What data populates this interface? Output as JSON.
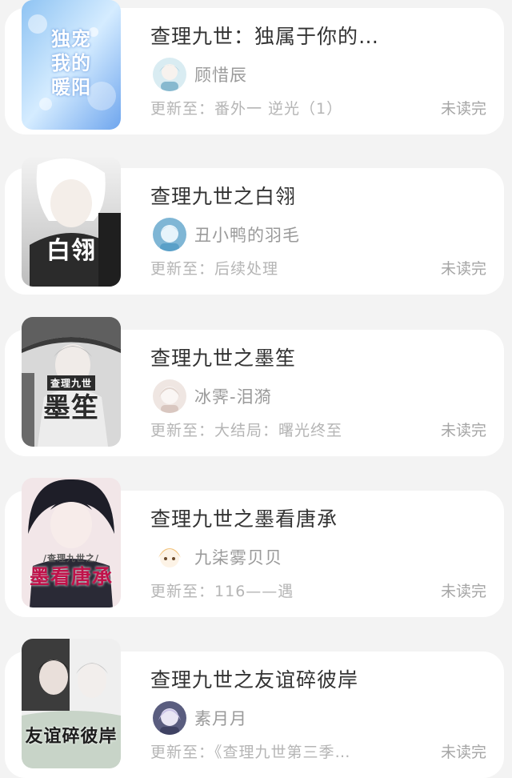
{
  "books": [
    {
      "title": "查理九世：独属于你的…",
      "author": "顾惜辰",
      "update_label": "更新至：",
      "update_chapter": "番外一  逆光（1）",
      "status": "未读完",
      "cover_icon": "book-cover-image",
      "avatar_icon": "author-avatar"
    },
    {
      "title": "查理九世之白翎",
      "author": "丑小鸭的羽毛",
      "update_label": "更新至：",
      "update_chapter": "后续处理",
      "status": "未读完",
      "cover_icon": "book-cover-image",
      "avatar_icon": "author-avatar"
    },
    {
      "title": "查理九世之墨笙",
      "author": "冰霁-泪漪",
      "update_label": "更新至：",
      "update_chapter": "大结局：曙光终至",
      "status": "未读完",
      "cover_icon": "book-cover-image",
      "avatar_icon": "author-avatar"
    },
    {
      "title": "查理九世之墨看唐承",
      "author": "九柒雾贝贝",
      "update_label": "更新至：",
      "update_chapter": "116——遇",
      "status": "未读完",
      "cover_icon": "book-cover-image",
      "avatar_icon": "author-avatar"
    },
    {
      "title": "查理九世之友谊碎彼岸",
      "author": "素月月",
      "update_label": "更新至：",
      "update_chapter": "《查理九世第三季…",
      "status": "未读完",
      "cover_icon": "book-cover-image",
      "avatar_icon": "author-avatar"
    }
  ],
  "cover_art": [
    {
      "lines": [
        "独宠",
        "我的",
        "暖阳"
      ],
      "colors": [
        "#7fb7f0",
        "#cfe6ff",
        "#a0c6ff"
      ],
      "text_color": "#ffffff"
    },
    {
      "lines": [
        "白翎"
      ],
      "colors": [
        "#e8e8e8",
        "#c9c9c9",
        "#8f8f8f"
      ],
      "text_color": "#ffffff"
    },
    {
      "lines": [
        "查理九世",
        "墨笙"
      ],
      "colors": [
        "#9a9a9a",
        "#dcdcdc",
        "#5b5b5b"
      ],
      "text_color": "#2b2b2b"
    },
    {
      "lines": [
        "/查理九世之/",
        "墨看唐承"
      ],
      "colors": [
        "#1e1e28",
        "#f2e6e8",
        "#d6c9cf"
      ],
      "text_color": "#c0124a"
    },
    {
      "lines": [
        "友谊碎彼岸"
      ],
      "colors": [
        "#3c3c3c",
        "#c8d4c8",
        "#efefef"
      ],
      "text_color": "#1c1c1c"
    }
  ],
  "avatar_colors": [
    [
      "#d9ecf2",
      "#87b9cf"
    ],
    [
      "#7fb6d5",
      "#e7f4fb"
    ],
    [
      "#efe6e2",
      "#d9c7c0"
    ],
    [
      "#f8e6c8",
      "#f1c27b"
    ],
    [
      "#5a5d7f",
      "#c9c2e6"
    ]
  ]
}
